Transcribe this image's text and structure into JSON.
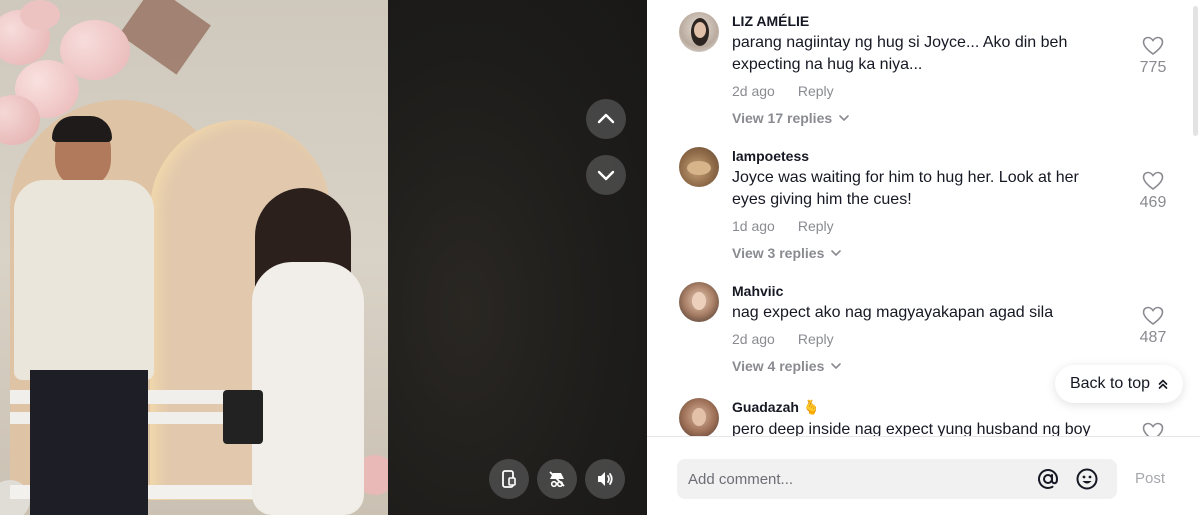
{
  "colors": {
    "text_primary": "#161823",
    "text_secondary": "#8a8b91",
    "video_background": "#1c1b19",
    "input_background": "#f1f1f2",
    "post_disabled": "#a7a8ad"
  },
  "video": {
    "controls": {
      "prev_icon": "chevron-up-icon",
      "next_icon": "chevron-down-icon",
      "bottom_icons": [
        "phone-device-icon",
        "incognito-hat-icon",
        "volume-icon"
      ]
    }
  },
  "comments": [
    {
      "username": "LIZ AMÉLIE",
      "text": "parang nagiintay ng hug si Joyce... Ako din beh expecting na hug ka niya...",
      "time": "2d ago",
      "reply_label": "Reply",
      "view_replies": "View 17 replies",
      "likes": "775"
    },
    {
      "username": "lampoetess",
      "text": "Joyce was waiting for him to hug her. Look at her eyes giving him the cues!",
      "time": "1d ago",
      "reply_label": "Reply",
      "view_replies": "View 3 replies",
      "likes": "469"
    },
    {
      "username": "Mahviic",
      "text": "nag expect ako nag magyayakapan agad sila",
      "time": "2d ago",
      "reply_label": "Reply",
      "view_replies": "View 4 replies",
      "likes": "487"
    },
    {
      "username": "Guadazah",
      "username_emoji": "🫰",
      "text": "pero deep inside nag expect yung husband ng boy",
      "time": "",
      "reply_label": "",
      "view_replies": "",
      "likes": ""
    }
  ],
  "back_to_top": {
    "label": "Back to top"
  },
  "footer": {
    "input_placeholder": "Add comment...",
    "mention_icon": "at-icon",
    "emoji_icon": "emoji-icon",
    "post_label": "Post"
  }
}
